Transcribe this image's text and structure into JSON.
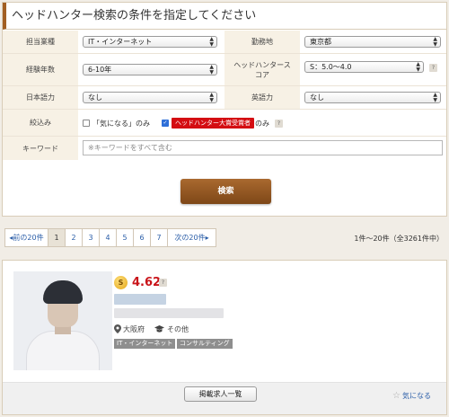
{
  "search": {
    "title": "ヘッドハンター検索の条件を指定してください",
    "industry": {
      "label": "担当業種",
      "value": "IT・インターネット"
    },
    "location": {
      "label": "勤務地",
      "value": "東京都"
    },
    "experience": {
      "label": "経験年数",
      "value": "6-10年"
    },
    "hh_score": {
      "label_line1": "ヘッドハンタース",
      "label_line2": "コア",
      "value": "S：5.0〜4.0",
      "help": "?"
    },
    "japanese": {
      "label": "日本語力",
      "value": "なし"
    },
    "english": {
      "label": "英語力",
      "value": "なし"
    },
    "filter": {
      "label": "絞込み",
      "favorite_only": "「気になる」のみ",
      "award_badge": "ヘッドハンター大賞受賞者",
      "award_suffix": "のみ",
      "help": "?"
    },
    "keyword": {
      "label": "キーワード",
      "placeholder": "※キーワードをすべて含む"
    },
    "submit": "検索"
  },
  "pagination": {
    "prev": "前の20件",
    "pages": [
      "1",
      "2",
      "3",
      "4",
      "5",
      "6",
      "7"
    ],
    "current": "1",
    "next": "次の20件",
    "count_text": "1件〜20件（全3261件中）"
  },
  "result": {
    "score_badge": "S",
    "score": "4.62",
    "score_help": "?",
    "location": "大阪府",
    "education": "その他",
    "tags": [
      "IT・インターネット",
      "コンサルティング"
    ],
    "jobs_button": "掲載求人一覧",
    "favorite": "気になる"
  },
  "colors": {
    "brand_brown": "#8f5321",
    "award_red": "#d40d12",
    "link_blue": "#2b5ea8",
    "score_red": "#c9141a"
  },
  "icons": [
    "chevron-updown-icon",
    "check-icon",
    "help-icon",
    "chevron-left-icon",
    "chevron-right-icon",
    "coin-icon",
    "pin-icon",
    "graduation-cap-icon",
    "star-icon"
  ]
}
